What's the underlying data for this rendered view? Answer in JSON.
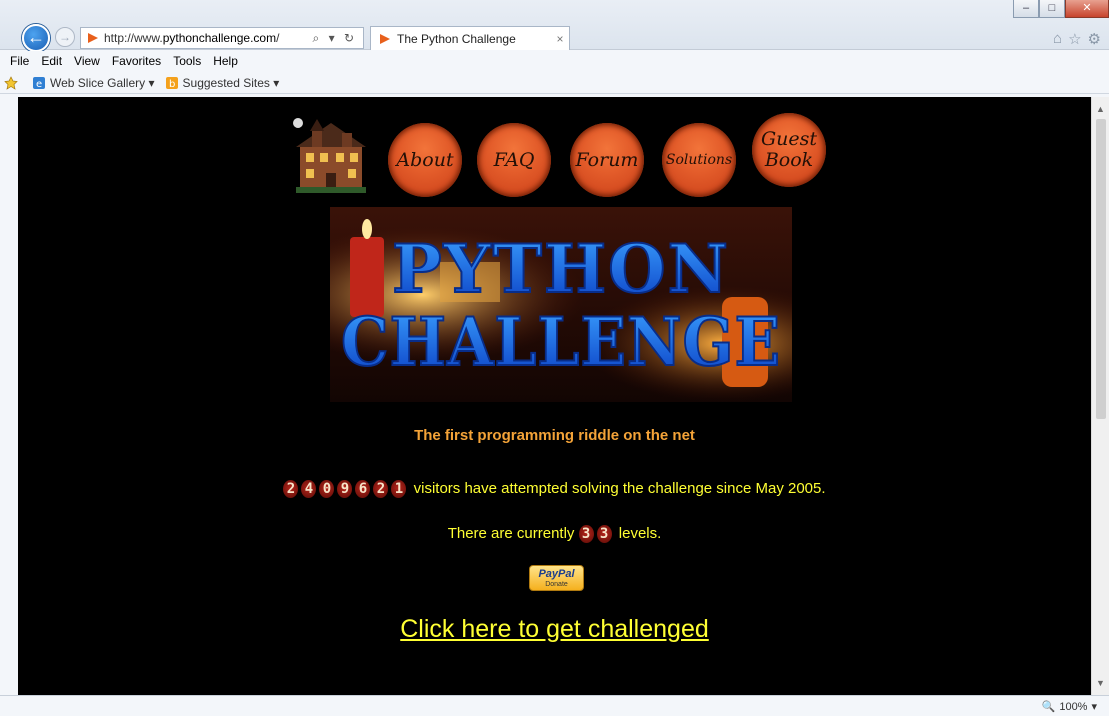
{
  "browser": {
    "address_url_prefix": "http://www.",
    "address_url_domain": "pythonchallenge.com",
    "address_url_suffix": "/",
    "tab_title": "The Python Challenge",
    "tab_close": "×",
    "search_glyph": "⌕ ▾ ↻",
    "menu": {
      "file": "File",
      "edit": "Edit",
      "view": "View",
      "favorites": "Favorites",
      "tools": "Tools",
      "help": "Help"
    },
    "favorites_bar": {
      "web_slice": "Web Slice Gallery ▾",
      "suggested": "Suggested Sites ▾"
    },
    "zoom": "100%",
    "zoom_arrow": "▾"
  },
  "page": {
    "nav": {
      "about": "About",
      "faq": "FAQ",
      "forum": "Forum",
      "solutions": "Solutions",
      "guestbook_line1": "Guest",
      "guestbook_line2": "Book"
    },
    "banner_line1": "PYTHON",
    "banner_line2": "CHALLENGE",
    "tagline": "The first programming riddle on the net",
    "visitor_digits": [
      "2",
      "4",
      "0",
      "9",
      "6",
      "2",
      "1"
    ],
    "visitors_text": "visitors have attempted solving the challenge since May 2005.",
    "levels_prefix": "There are currently",
    "level_digits": [
      "3",
      "3"
    ],
    "levels_suffix": "levels.",
    "paypal_brand": "PayPal",
    "paypal_donate": "Donate",
    "challenge_link": "Click here to get challenged"
  }
}
